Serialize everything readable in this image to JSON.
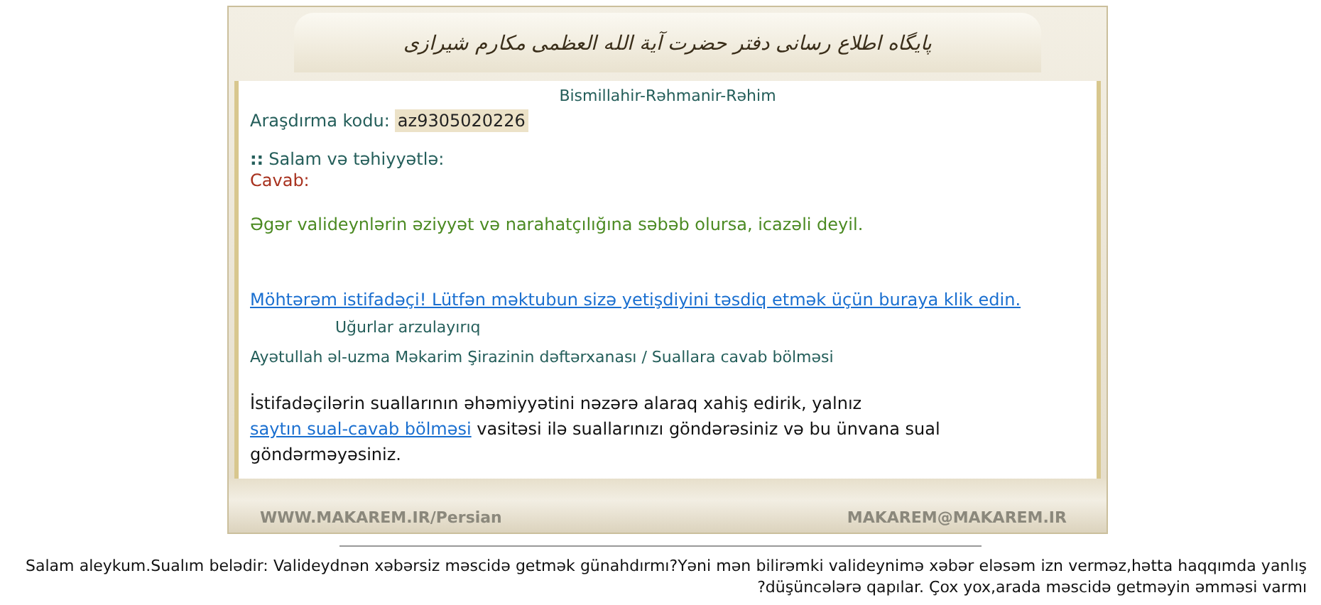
{
  "header": {
    "calligraphy": "پایگاه اطلاع رسانی دفتر حضرت آیة الله العظمی مکارم شیرازی"
  },
  "letter": {
    "greeting_top": "Bismillahir-Rəhmanir-Rəhim",
    "code_label": "Araşdırma kodu:",
    "code": "az9305020226",
    "salutation_mark": "::",
    "salutation": "Salam və təhiyyətlə:",
    "answer_label": "Cavab:",
    "answer": "Əgər valideynlərin əziyyət və narahatçılığına səbəb olursa, icazəli deyil.",
    "confirm_link": "Möhtərəm istifadəçi! Lütfən məktubun sizə yetişdiyini təsdiq etmək üçün buraya klik edin.",
    "wishes": "Uğurlar arzulayırıq",
    "signature": "Ayətullah əl-uzma Məkarim Şirazinin dəftərxanası / Suallara cavab bölməsi",
    "notice_before": "İstifadəçilərin suallarının əhəmiyyətini nəzərə alaraq xahiş edirik, yalnız",
    "notice_link": "saytın sual-cavab bölməsi",
    "notice_after": "vasitəsi ilə suallarınızı göndərəsiniz və bu ünvana sual göndərməyəsiniz."
  },
  "footer": {
    "left": "WWW.MAKAREM.IR/Persian",
    "right": "MAKAREM@MAKAREM.IR"
  },
  "question": "Salam aleykum.Sualım belədir: Valideydnən xəbərsiz məscidə getmək günahdırmı?Yəni mən bilirəmki valideynimə xəbər eləsəm izn verməz,hətta haqqımda yanlış düşüncələrə qapılar. Çox yox,arada məscidə getməyin əmməsi varmı?"
}
